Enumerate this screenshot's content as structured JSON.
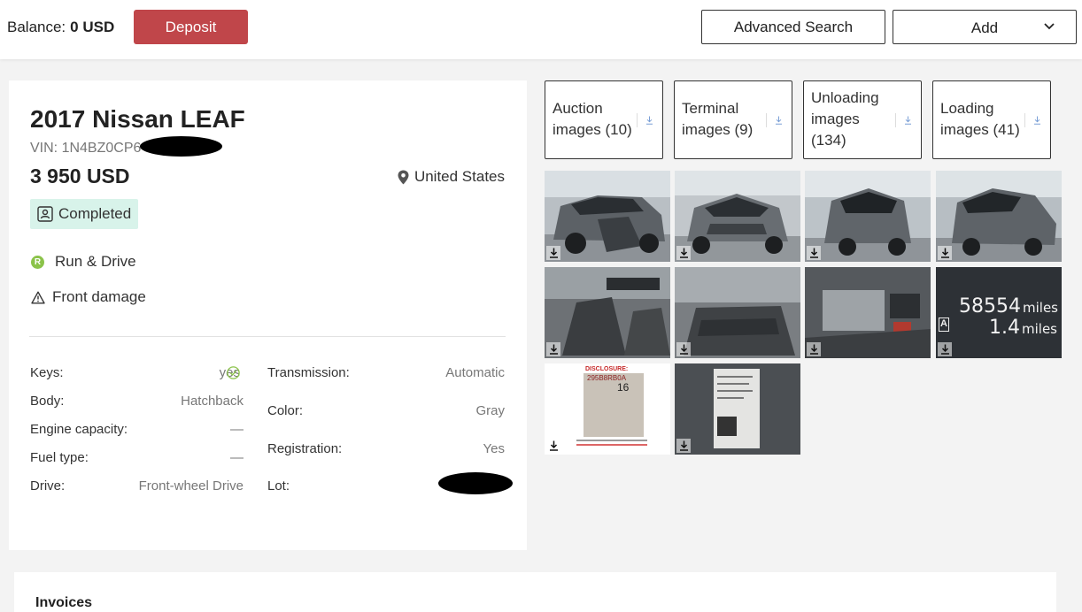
{
  "header": {
    "balance_label": "Balance:",
    "balance_value": "0 USD",
    "deposit_label": "Deposit",
    "advanced_search_label": "Advanced Search",
    "add_label": "Add"
  },
  "vehicle": {
    "title": "2017 Nissan LEAF",
    "vin": "VIN: 1N4BZ0CP6",
    "price": "3 950 USD",
    "location": "United States",
    "status": "Completed",
    "condition_badge": "R",
    "condition": "Run & Drive",
    "damage": "Front damage"
  },
  "specs_left": [
    {
      "label": "Keys:",
      "value": "yes"
    },
    {
      "label": "Body:",
      "value": "Hatchback"
    },
    {
      "label": "Engine capacity:",
      "value": "—"
    },
    {
      "label": "Fuel type:",
      "value": "—"
    },
    {
      "label": "Drive:",
      "value": "Front-wheel Drive"
    }
  ],
  "specs_right": [
    {
      "label": "Transmission:",
      "value": "Automatic"
    },
    {
      "label": "Color:",
      "value": "Gray"
    },
    {
      "label": "Registration:",
      "value": "Yes"
    },
    {
      "label": "Lot:",
      "value": ""
    }
  ],
  "image_categories": [
    {
      "label": "Auction images (10)"
    },
    {
      "label": "Terminal images (9)"
    },
    {
      "label": "Unloading images (134)"
    },
    {
      "label": "Loading images (41)"
    }
  ],
  "photos": {
    "odometer_miles": "58554",
    "odometer_trip": "1.4",
    "odometer_unit": "miles",
    "odometer_mode": "A",
    "disclosure_title": "DISCLOSURE:",
    "disclosure_code": "295B8RB0A",
    "disclosure_num": "16"
  },
  "invoices": {
    "title": "Invoices"
  },
  "colors": {
    "deposit": "#c0464a",
    "status_bg": "#d8f3ea",
    "run_drive": "#8bc34a",
    "check": "#8bc34a"
  }
}
